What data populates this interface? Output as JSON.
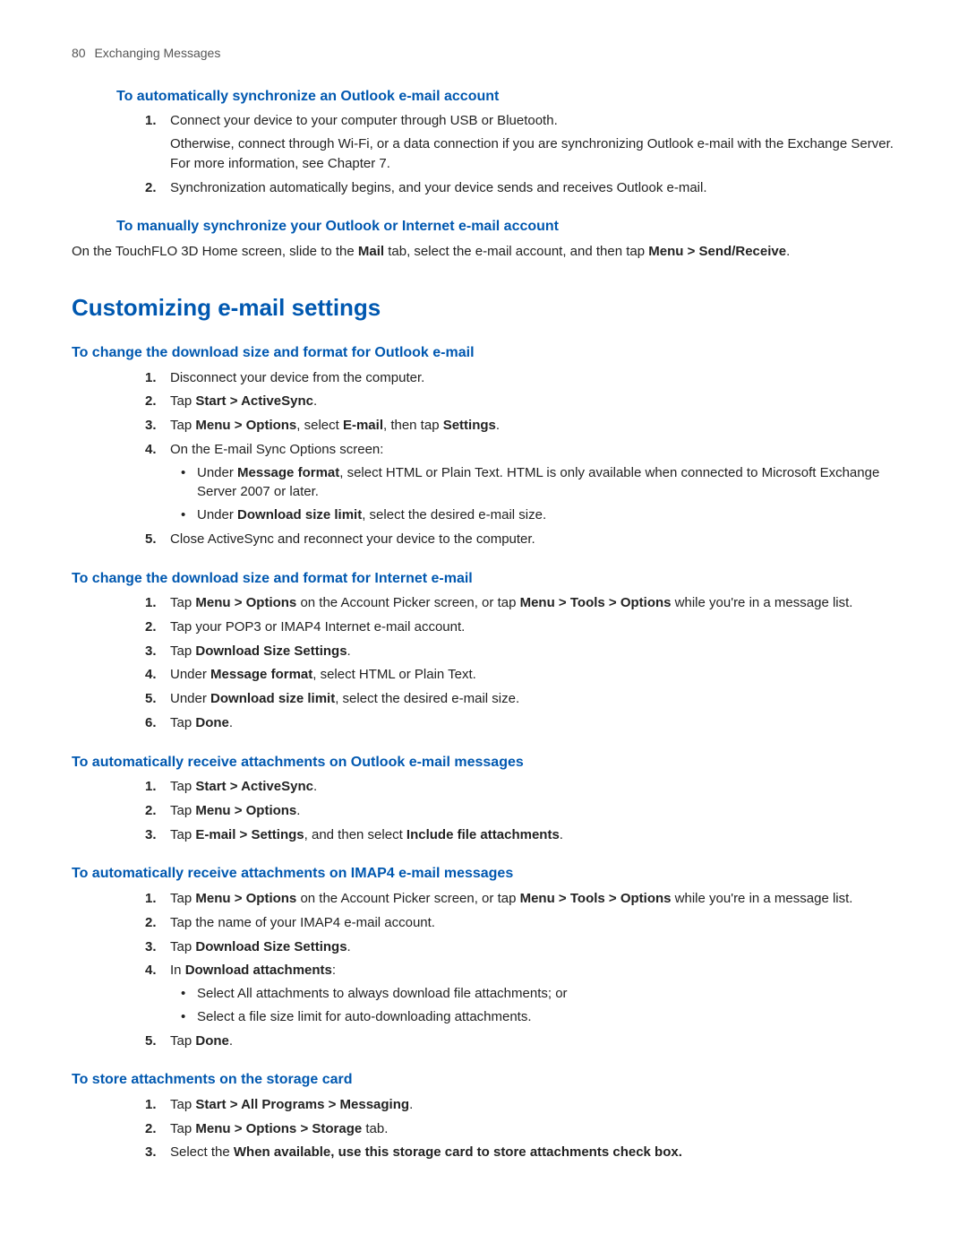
{
  "header": {
    "pagenum": "80",
    "title": "Exchanging Messages"
  },
  "sec1": {
    "heading": "To automatically synchronize an Outlook e-mail account",
    "items": [
      {
        "num": "1",
        "p1": "Connect your device to your computer through USB or Bluetooth.",
        "p2": "Otherwise, connect through Wi-Fi, or a data connection if you are synchronizing Outlook e-mail with the Exchange Server. For more information, see Chapter 7."
      },
      {
        "num": "2",
        "p1": "Synchronization automatically begins, and your device sends and receives Outlook e-mail."
      }
    ]
  },
  "sec2": {
    "heading": "To manually synchronize your Outlook or Internet e-mail account",
    "line_a": "On the TouchFLO 3D Home screen, slide to the ",
    "line_b": "Mail",
    "line_c": " tab, select the e-mail account, and then tap ",
    "line_d": "Menu > Send/Receive",
    "line_e": "."
  },
  "main_heading": "Customizing e-mail settings",
  "sec3": {
    "heading": "To change the download size and format for Outlook e-mail",
    "i1": {
      "num": "1",
      "text": "Disconnect your device from the computer."
    },
    "i2": {
      "num": "2",
      "a": "Tap ",
      "b": "Start > ActiveSync",
      "c": "."
    },
    "i3": {
      "num": "3",
      "a": "Tap ",
      "b": "Menu > Options",
      "c": ", select ",
      "d": "E-mail",
      "e": ", then tap ",
      "f": "Settings",
      "g": "."
    },
    "i4": {
      "num": "4",
      "text": "On the E-mail Sync Options screen:",
      "b1": {
        "a": "Under ",
        "b": "Message format",
        "c": ", select HTML or Plain Text. HTML is only available when connected to Microsoft Exchange Server 2007 or later."
      },
      "b2": {
        "a": "Under ",
        "b": "Download size limit",
        "c": ", select the desired e-mail size."
      }
    },
    "i5": {
      "num": "5",
      "text": "Close ActiveSync and reconnect your device to the computer."
    }
  },
  "sec4": {
    "heading": "To change the download size and format for Internet e-mail",
    "i1": {
      "num": "1",
      "a": "Tap ",
      "b": "Menu > Options",
      "c": " on the Account Picker screen, or tap ",
      "d": "Menu > Tools > Options",
      "e": " while you're in a message list."
    },
    "i2": {
      "num": "2",
      "text": "Tap your POP3 or IMAP4 Internet e-mail account."
    },
    "i3": {
      "num": "3",
      "a": "Tap ",
      "b": "Download Size Settings",
      "c": "."
    },
    "i4": {
      "num": "4",
      "a": "Under ",
      "b": "Message format",
      "c": ", select HTML or Plain Text."
    },
    "i5": {
      "num": "5",
      "a": "Under ",
      "b": "Download size limit",
      "c": ", select the desired e-mail size."
    },
    "i6": {
      "num": "6",
      "a": "Tap ",
      "b": "Done",
      "c": "."
    }
  },
  "sec5": {
    "heading": "To automatically receive attachments on Outlook e-mail messages",
    "i1": {
      "num": "1",
      "a": "Tap ",
      "b": "Start > ActiveSync",
      "c": "."
    },
    "i2": {
      "num": "2",
      "a": "Tap ",
      "b": "Menu > Options",
      "c": "."
    },
    "i3": {
      "num": "3",
      "a": "Tap ",
      "b": "E-mail > Settings",
      "c": ", and then select ",
      "d": "Include file attachments",
      "e": "."
    }
  },
  "sec6": {
    "heading": "To automatically receive attachments on IMAP4 e-mail messages",
    "i1": {
      "num": "1",
      "a": "Tap ",
      "b": "Menu > Options",
      "c": " on the Account Picker screen, or tap ",
      "d": "Menu > Tools > Options",
      "e": " while you're in a message list."
    },
    "i2": {
      "num": "2",
      "text": "Tap the name of your IMAP4 e-mail account."
    },
    "i3": {
      "num": "3",
      "a": "Tap ",
      "b": "Download Size Settings",
      "c": "."
    },
    "i4": {
      "num": "4",
      "a": "In ",
      "b": "Download attachments",
      "c": ":",
      "b1": "Select All attachments to always download file attachments; or",
      "b2": "Select a file size limit for auto-downloading attachments."
    },
    "i5": {
      "num": "5",
      "a": "Tap ",
      "b": "Done",
      "c": "."
    }
  },
  "sec7": {
    "heading": "To store attachments on the storage card",
    "i1": {
      "num": "1",
      "a": "Tap ",
      "b": "Start > All Programs > Messaging",
      "c": "."
    },
    "i2": {
      "num": "2",
      "a": "Tap ",
      "b": "Menu > Options > Storage",
      "c": " tab."
    },
    "i3": {
      "num": "3",
      "a": "Select the ",
      "b": "When available, use this storage card to store attachments check box."
    }
  }
}
